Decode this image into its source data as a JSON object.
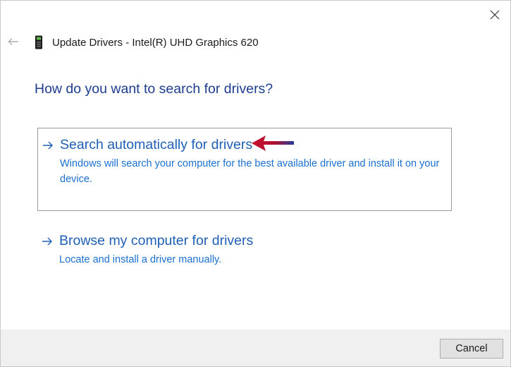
{
  "window": {
    "title": "Update Drivers - Intel(R) UHD Graphics 620",
    "title_icon": "display-adapter-icon",
    "back_icon": "back-arrow-icon",
    "close_icon": "close-icon"
  },
  "heading": "How do you want to search for drivers?",
  "options": [
    {
      "title": "Search automatically for drivers",
      "description": "Windows will search your computer for the best available driver and install it on your device.",
      "selected": true,
      "icon": "arrow-right-icon"
    },
    {
      "title": "Browse my computer for drivers",
      "description": "Locate and install a driver manually.",
      "selected": false,
      "icon": "arrow-right-icon"
    }
  ],
  "footer": {
    "cancel_label": "Cancel"
  },
  "annotation": {
    "icon": "red-pointer-arrow-icon",
    "colors": [
      "#c8102e",
      "#1f3c9a"
    ]
  },
  "colors": {
    "heading": "#1e3d8f",
    "link": "#1f5fb6",
    "link_description": "#1a6fd0",
    "footer_bg": "#f0f0f0"
  }
}
